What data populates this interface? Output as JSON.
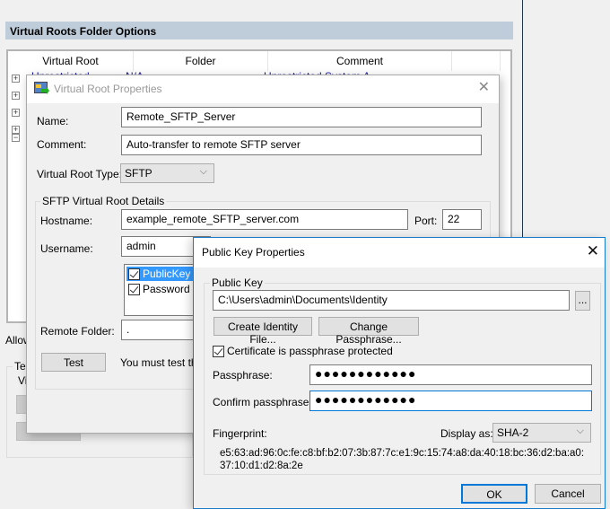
{
  "background": {
    "section_title": "Virtual Roots Folder Options",
    "list_columns": [
      "Virtual Root",
      "Folder",
      "Comment",
      ""
    ],
    "first_row": {
      "virtual_root": "Unrestricted...",
      "folder": "N/A",
      "comment": "Unrestricted System A..."
    },
    "tree_toggles": [
      "+",
      "+",
      "+",
      "+",
      "−"
    ],
    "allow_label": "Allow",
    "test_group_label": "Tes",
    "test_group_text": "Vir"
  },
  "vrp_dialog": {
    "title": "Virtual Root Properties",
    "name_label": "Name:",
    "name_value": "Remote_SFTP_Server",
    "comment_label": "Comment:",
    "comment_value": "Auto-transfer to remote SFTP server",
    "type_label": "Virtual Root Type:",
    "type_value": "SFTP",
    "details_group": "SFTP Virtual Root Details",
    "hostname_label": "Hostname:",
    "hostname_value": "example_remote_SFTP_server.com",
    "port_label": "Port:",
    "port_value": "22",
    "username_label": "Username:",
    "username_value": "admin",
    "auth_methods": [
      {
        "label": "PublicKey",
        "checked": true,
        "selected": true
      },
      {
        "label": "Password",
        "checked": true,
        "selected": false
      }
    ],
    "remote_folder_label": "Remote Folder:",
    "remote_folder_value": ".",
    "test_button": "Test",
    "test_note": "You must test the"
  },
  "pkp_dialog": {
    "title": "Public Key Properties",
    "group_label": "Public Key",
    "path_value": "C:\\Users\\admin\\Documents\\Identity",
    "browse_button": "...",
    "create_identity_button": "Create Identity File...",
    "change_passphrase_button": "Change Passphrase...",
    "protected_checkbox": "Certificate is passphrase protected",
    "protected_checked": true,
    "passphrase_label": "Passphrase:",
    "passphrase_value": "●●●●●●●●●●●●",
    "confirm_label": "Confirm  passphrase:",
    "confirm_value": "●●●●●●●●●●●●",
    "fingerprint_label": "Fingerprint:",
    "display_as_label": "Display as:",
    "display_as_value": "SHA-2",
    "fingerprint_line1": "e5:63:ad:96:0c:fe:c8:bf:b2:07:3b:87:7c:e1:9c:15:74:a8:da:40:18:bc:36:d2:ba:a0:",
    "fingerprint_line2": "37:10:d1:d2:8a:2e",
    "ok_button": "OK",
    "cancel_button": "Cancel"
  }
}
